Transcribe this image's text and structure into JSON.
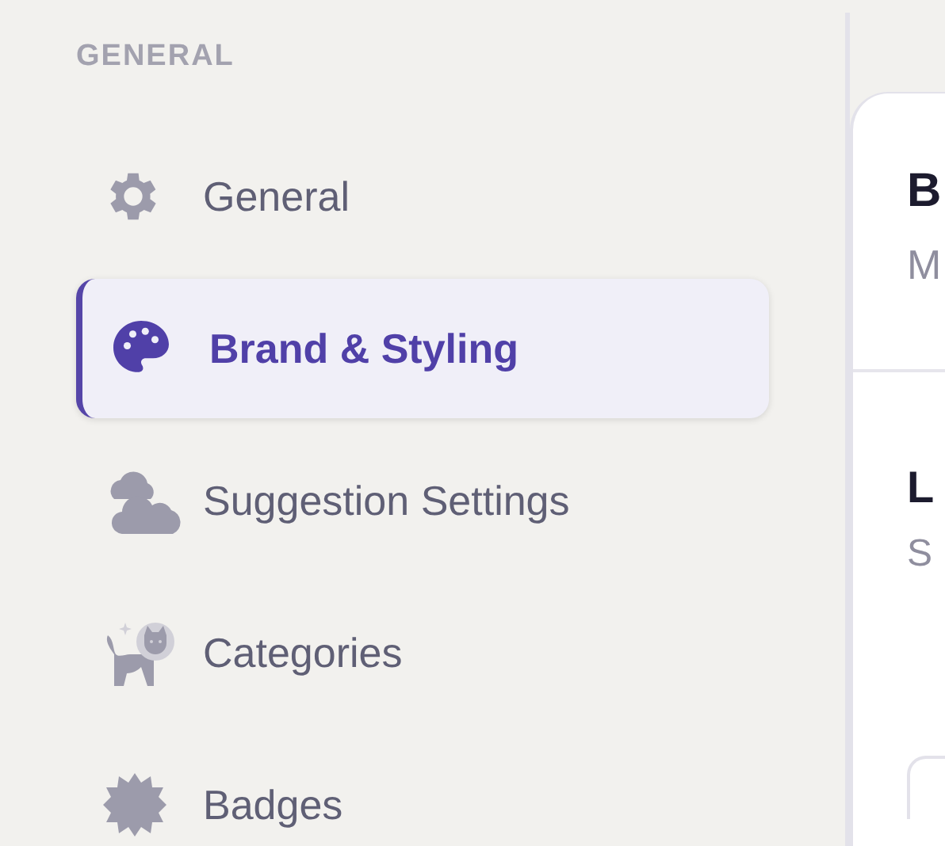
{
  "sidebar": {
    "section_label": "GENERAL",
    "items": [
      {
        "label": "General",
        "kind": "gear",
        "selected": false
      },
      {
        "label": "Brand & Styling",
        "kind": "palette",
        "selected": true
      },
      {
        "label": "Suggestion Settings",
        "kind": "clouds",
        "selected": false
      },
      {
        "label": "Categories",
        "kind": "cat",
        "selected": false
      },
      {
        "label": "Badges",
        "kind": "seal",
        "selected": false
      }
    ]
  },
  "panel": {
    "title": "B",
    "subtitle": "M",
    "section_title": "L",
    "section_subtitle": "S"
  }
}
